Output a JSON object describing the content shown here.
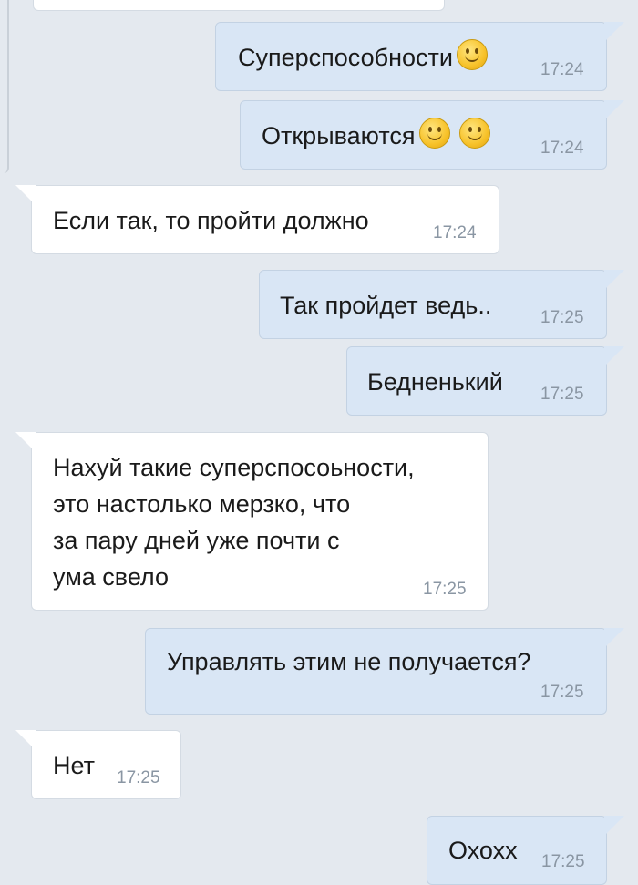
{
  "chat": {
    "messages": [
      {
        "text": "Суперспособности",
        "emoji_count": 1,
        "time": "17:24",
        "direction": "out"
      },
      {
        "text": "Открываются",
        "emoji_count": 2,
        "time": "17:24",
        "direction": "out"
      },
      {
        "text": "Если так, то пройти должно",
        "time": "17:24",
        "direction": "in"
      },
      {
        "text": "Так пройдет ведь..",
        "time": "17:25",
        "direction": "out"
      },
      {
        "text": "Бедненький",
        "time": "17:25",
        "direction": "out"
      },
      {
        "lines": [
          "Нахуй такие суперспосоьности,",
          "это настолько мерзко, что",
          "за пару дней уже почти с",
          "ума свело"
        ],
        "time": "17:25",
        "direction": "in"
      },
      {
        "text": "Управлять этим не получается?",
        "time": "17:25",
        "direction": "out"
      },
      {
        "text": "Нет",
        "time": "17:25",
        "direction": "in"
      },
      {
        "text": "Охохх",
        "time": "17:25",
        "direction": "out"
      }
    ],
    "emoji_icon": "slightly-smiling-face-icon"
  },
  "colors": {
    "background": "#e4e9ef",
    "incoming_bubble": "#ffffff",
    "outgoing_bubble": "#d9e6f5",
    "time_text": "#8a96a3"
  }
}
